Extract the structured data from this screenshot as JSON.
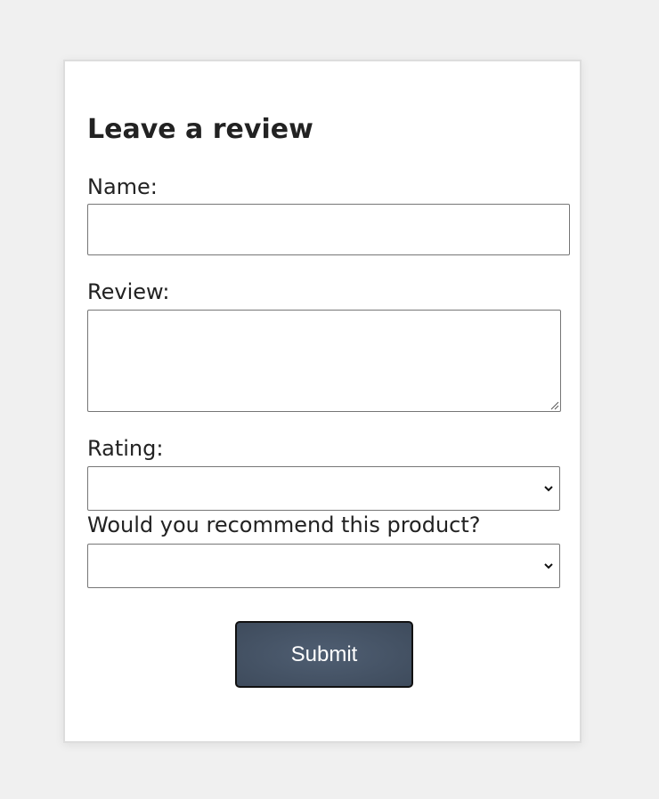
{
  "form": {
    "title": "Leave a review",
    "name_label": "Name:",
    "name_value": "",
    "review_label": "Review:",
    "review_value": "",
    "rating_label": "Rating:",
    "rating_selected": "",
    "recommend_label": "Would you recommend this product?",
    "recommend_selected": "",
    "submit_label": "Submit"
  },
  "colors": {
    "page_background": "#f0f0f0",
    "card_background": "#ffffff",
    "button_background": "#46535f",
    "button_text": "#ffffff"
  },
  "icons": {
    "select_arrow": "chevron-down-icon",
    "textarea_resize": "resize-grip-icon"
  }
}
